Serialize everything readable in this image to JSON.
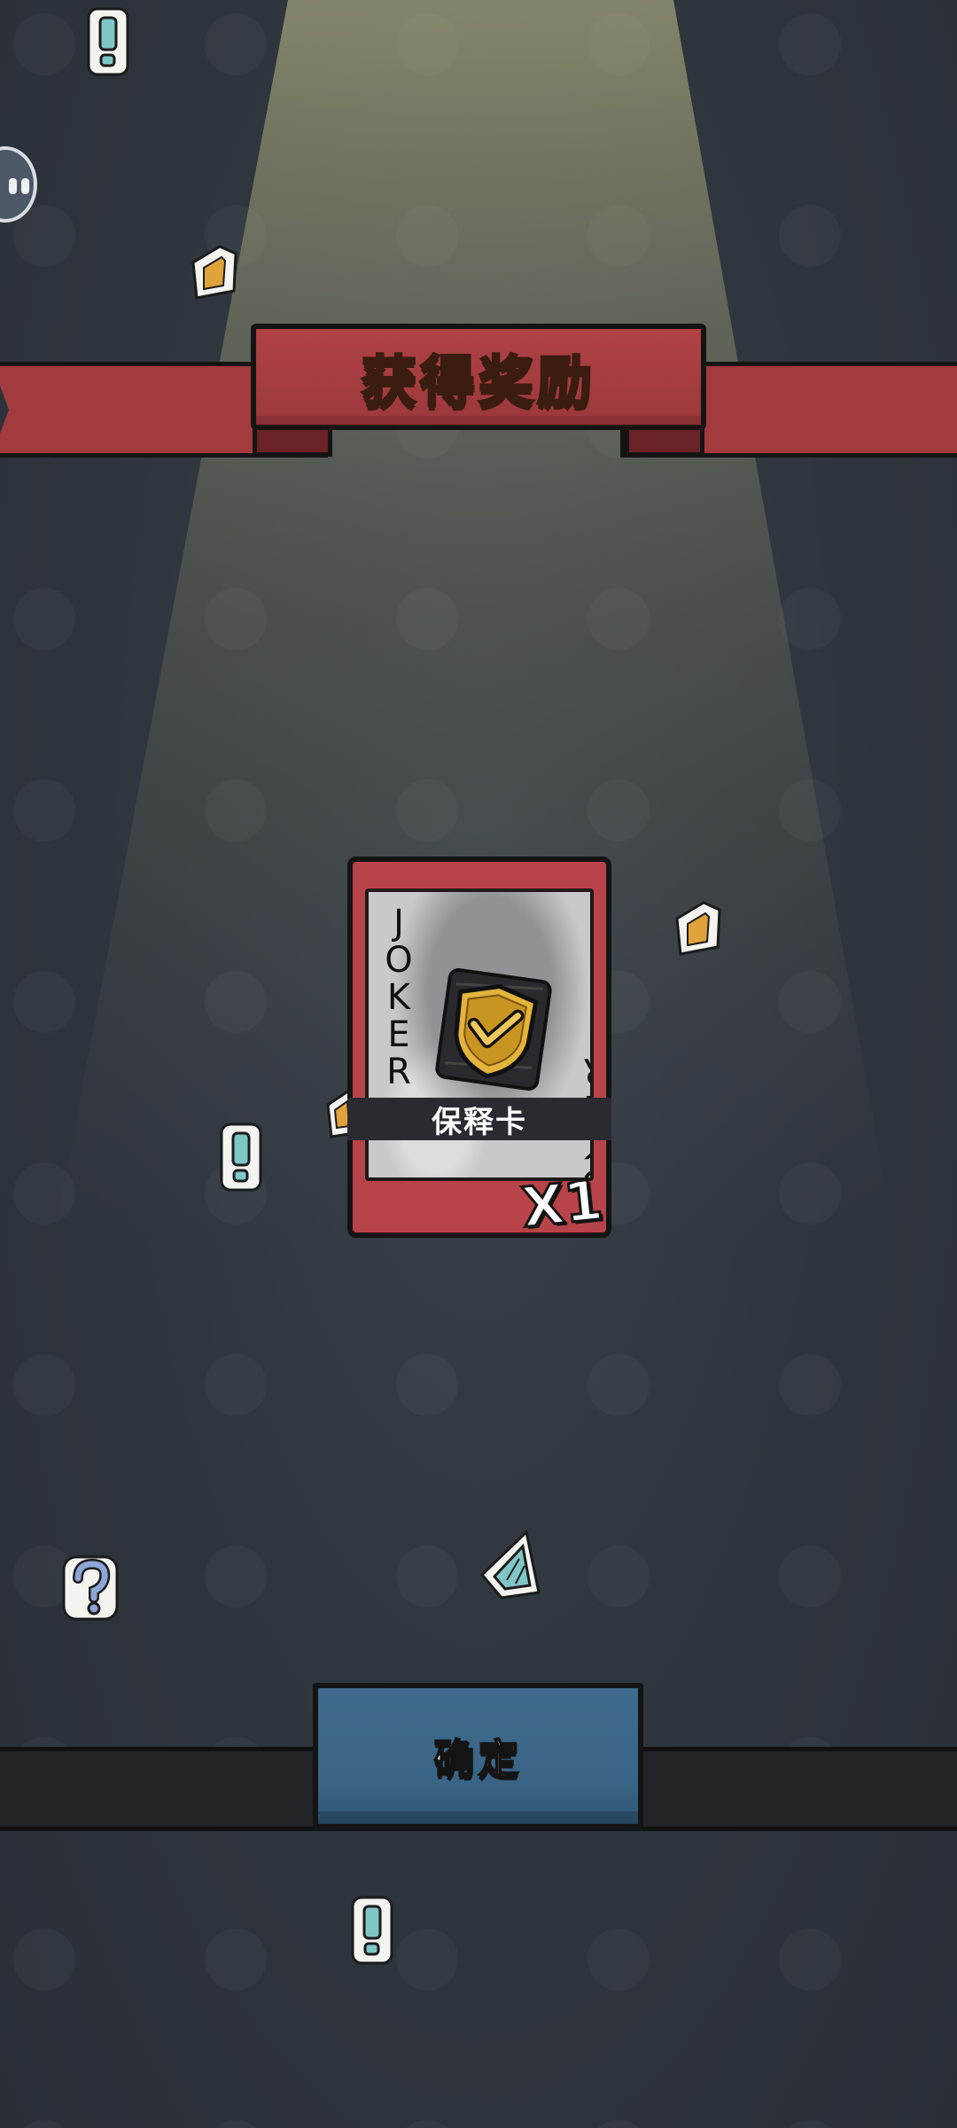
{
  "banner": {
    "title": "获得奖励"
  },
  "reward_card": {
    "corner_text": "JOKER",
    "name": "保释卡",
    "quantity": "X1"
  },
  "confirm_button": {
    "label": "确定"
  },
  "colors": {
    "background": "#2f353c",
    "ribbon": "#a23b3e",
    "ribbon_title": "#f2cf83",
    "card_frame": "#b8444a",
    "button": "#3a6485"
  },
  "icons": [
    "exclamation-sticker-icon",
    "ticket-sticker-icon",
    "question-sticker-icon",
    "triangle-sticker-icon",
    "shield-check-icon",
    "side-tab-icon"
  ]
}
